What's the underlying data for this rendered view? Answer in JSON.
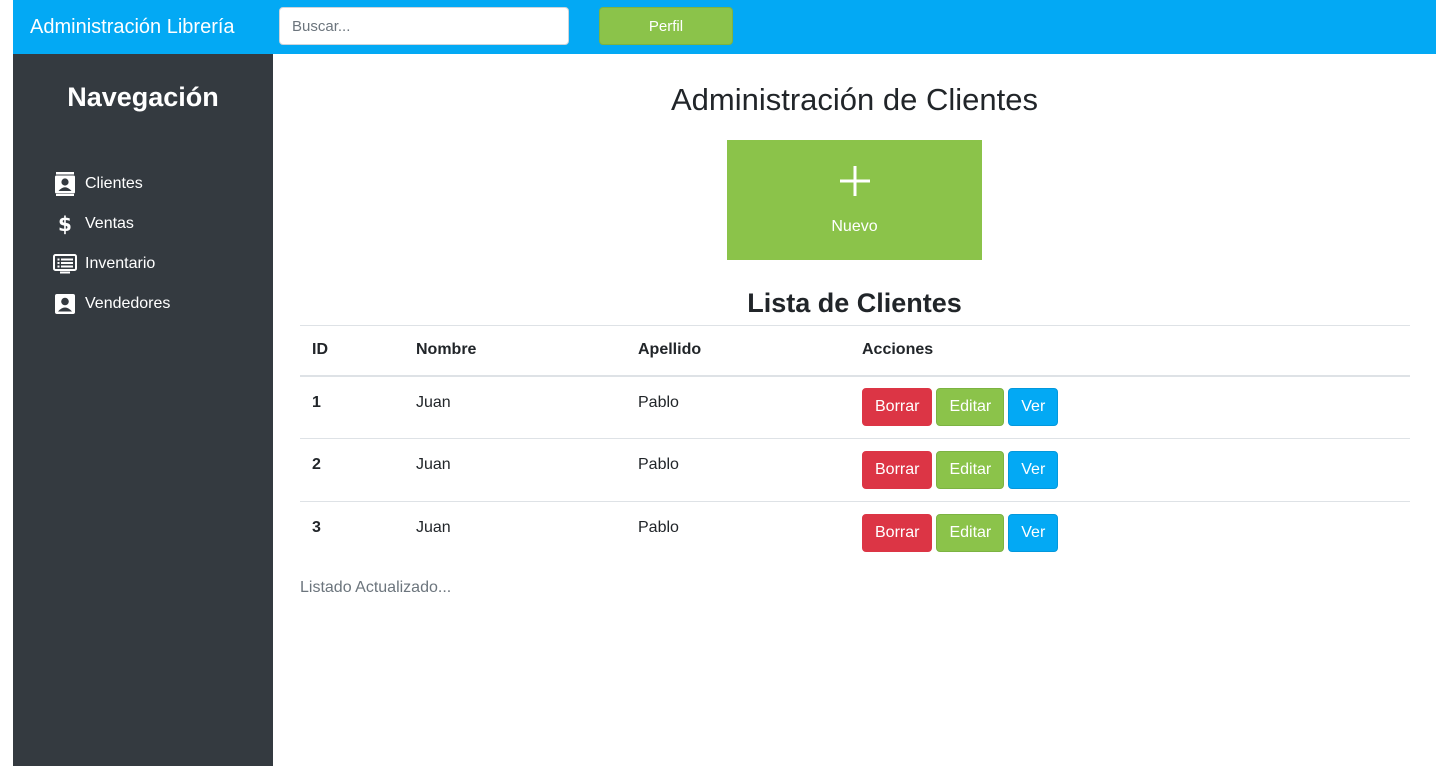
{
  "app": {
    "brand": "Administración Librería"
  },
  "topbar": {
    "search_placeholder": "Buscar...",
    "profile_label": "Perfil"
  },
  "sidebar": {
    "title": "Navegación",
    "items": [
      {
        "label": "Clientes",
        "icon": "contact-card-icon"
      },
      {
        "label": "Ventas",
        "icon": "dollar-icon"
      },
      {
        "label": "Inventario",
        "icon": "list-icon"
      },
      {
        "label": "Vendedores",
        "icon": "user-card-icon"
      }
    ]
  },
  "main": {
    "title": "Administración de Clientes",
    "new_tile": {
      "label": "Nuevo",
      "icon": "plus-icon"
    },
    "list_title": "Lista de Clientes",
    "table": {
      "headers": [
        "ID",
        "Nombre",
        "Apellido",
        "Acciones"
      ],
      "rows": [
        {
          "id": "1",
          "nombre": "Juan",
          "apellido": "Pablo"
        },
        {
          "id": "2",
          "nombre": "Juan",
          "apellido": "Pablo"
        },
        {
          "id": "3",
          "nombre": "Juan",
          "apellido": "Pablo"
        }
      ],
      "actions": {
        "delete": "Borrar",
        "edit": "Editar",
        "view": "Ver"
      }
    },
    "status": "Listado Actualizado..."
  },
  "colors": {
    "topbar": "#03a9f4",
    "sidebar": "#343a40",
    "success": "#8bc34a",
    "danger": "#dc3545",
    "info": "#03a9f4"
  }
}
